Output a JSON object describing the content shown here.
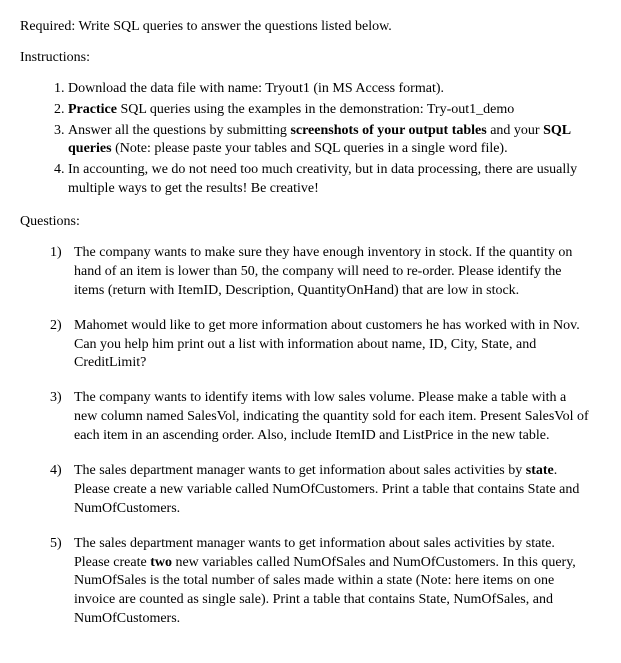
{
  "required_line": "Required: Write SQL queries to answer the questions listed below.",
  "instructions_label": "Instructions:",
  "instructions": [
    {
      "parts": [
        {
          "t": "Download the data file with name: Tryout1 (in MS Access format)."
        }
      ]
    },
    {
      "parts": [
        {
          "t": "Practice",
          "b": true
        },
        {
          "t": " SQL queries using the examples in the demonstration: Try-out1_demo"
        }
      ]
    },
    {
      "parts": [
        {
          "t": "Answer all the questions by submitting "
        },
        {
          "t": "screenshots of your output tables",
          "b": true
        },
        {
          "t": " and your "
        },
        {
          "t": "SQL queries",
          "b": true
        },
        {
          "t": " (Note: please paste your tables and SQL queries in a single word file)."
        }
      ]
    },
    {
      "parts": [
        {
          "t": "In accounting, we do not need too much creativity, but in data processing, there are usually multiple ways to get the results! Be creative!"
        }
      ]
    }
  ],
  "questions_label": "Questions:",
  "questions": [
    {
      "num": "1)",
      "parts": [
        {
          "t": "The company wants to make sure they have enough inventory in stock. If the quantity on hand of an item is lower than 50, the company will need to re-order. Please identify the items (return with ItemID, Description, QuantityOnHand) that are low in stock."
        }
      ]
    },
    {
      "num": "2)",
      "parts": [
        {
          "t": "Mahomet would like to get more information about customers he has worked with in Nov. Can you help him print out a list with information about name, ID, City, State, and CreditLimit?"
        }
      ]
    },
    {
      "num": "3)",
      "parts": [
        {
          "t": "The company wants to identify items with low sales volume. Please make a table with a new column named SalesVol, indicating the quantity sold for each item. Present SalesVol of each item in an ascending order. Also, include ItemID and ListPrice in the new table."
        }
      ]
    },
    {
      "num": "4)",
      "parts": [
        {
          "t": "The sales department manager wants to get information about sales activities by "
        },
        {
          "t": "state",
          "b": true
        },
        {
          "t": ". Please create a new variable called NumOfCustomers. Print a table that contains State and NumOfCustomers."
        }
      ]
    },
    {
      "num": "5)",
      "parts": [
        {
          "t": "The sales department manager wants to get information about sales activities by state. Please create "
        },
        {
          "t": "two",
          "b": true
        },
        {
          "t": " new variables called NumOfSales and NumOfCustomers. In this query, NumOfSales is the total number of sales made within a state (Note: here items on one invoice are counted as single sale). Print a table that contains State, NumOfSales, and NumOfCustomers."
        }
      ]
    }
  ]
}
